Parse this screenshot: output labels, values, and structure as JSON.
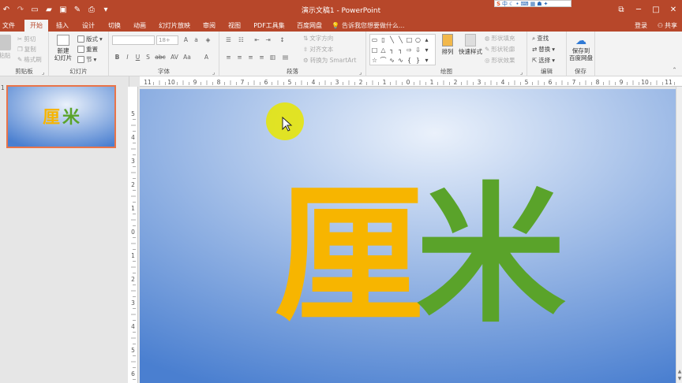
{
  "window": {
    "title": "演示文稿1 - PowerPoint",
    "controls": {
      "restore": "⧉",
      "minimize": "─",
      "maximize": "□",
      "close": "✕"
    }
  },
  "ime_bar": {
    "logo": "S",
    "mode": "中"
  },
  "tabs": [
    {
      "label": "文件",
      "active": false
    },
    {
      "label": "开始",
      "active": true
    },
    {
      "label": "插入",
      "active": false
    },
    {
      "label": "设计",
      "active": false
    },
    {
      "label": "切换",
      "active": false
    },
    {
      "label": "动画",
      "active": false
    },
    {
      "label": "幻灯片放映",
      "active": false
    },
    {
      "label": "审阅",
      "active": false
    },
    {
      "label": "视图",
      "active": false
    },
    {
      "label": "PDF工具集",
      "active": false
    },
    {
      "label": "百度网盘",
      "active": false
    }
  ],
  "tell_me": "告诉我您想要做什么...",
  "account": {
    "signin": "登录",
    "share": "共享"
  },
  "ribbon": {
    "clipboard": {
      "paste": "粘贴",
      "cut": "剪切",
      "copy": "复制",
      "format_painter": "格式刷",
      "group": "剪贴板"
    },
    "slides": {
      "new_slide_l1": "新建",
      "new_slide_l2": "幻灯片",
      "layout": "版式",
      "reset": "重置",
      "section": "节",
      "group": "幻灯片"
    },
    "font": {
      "font_name": "",
      "font_size": "18+",
      "bold": "B",
      "italic": "I",
      "underline": "U",
      "shadow": "S",
      "strike": "abc",
      "spacing": "AV",
      "case": "Aa",
      "color": "A",
      "group": "字体"
    },
    "paragraph": {
      "text_direction": "文字方向",
      "align_text": "对齐文本",
      "smartart": "转换为 SmartArt",
      "group": "段落"
    },
    "drawing": {
      "arrange": "排列",
      "quick_styles": "快速样式",
      "shape_fill": "形状填充",
      "shape_outline": "形状轮廓",
      "shape_effects": "形状效果",
      "group": "绘图"
    },
    "editing": {
      "find": "查找",
      "replace": "替换",
      "select": "选择",
      "group": "编辑"
    },
    "save": {
      "btn_l1": "保存到",
      "btn_l2": "百度网盘",
      "group": "保存"
    }
  },
  "slide_panel": {
    "number": "1"
  },
  "slide": {
    "char1": "厘",
    "char2": "米"
  },
  "colors": {
    "accent": "#b7472a",
    "char1": "#f7b500",
    "char2": "#5aa32a",
    "slide_bg_center": "#eaf1fb",
    "slide_bg_edge": "#4a7fd0"
  },
  "ruler": {
    "h_labels": [
      "11",
      "10",
      "9",
      "8",
      "7",
      "6",
      "5",
      "4",
      "3",
      "2",
      "1",
      "0",
      "1",
      "2",
      "3",
      "4",
      "5",
      "6",
      "7",
      "8",
      "9",
      "10",
      "11"
    ],
    "v_labels": [
      "5",
      "4",
      "3",
      "2",
      "1",
      "0",
      "1",
      "2",
      "3",
      "4",
      "5",
      "6"
    ]
  }
}
